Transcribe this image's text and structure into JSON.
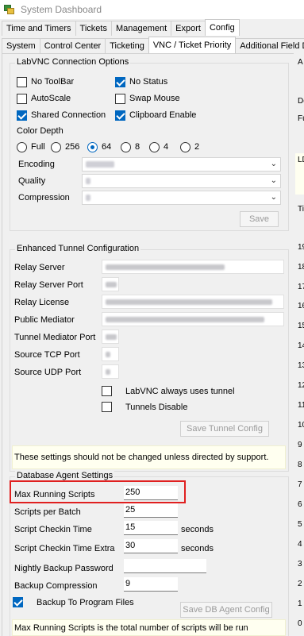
{
  "window": {
    "title": "System Dashboard"
  },
  "main_tabs": [
    "Time and Timers",
    "Tickets",
    "Management",
    "Export",
    "Config"
  ],
  "sub_tabs": [
    "System",
    "Control Center",
    "Ticketing",
    "VNC / Ticket Priority",
    "Additional Field D"
  ],
  "labvnc": {
    "title": "LabVNC Connection Options",
    "checkboxes": [
      {
        "label": "No ToolBar",
        "checked": false
      },
      {
        "label": "No Status",
        "checked": true
      },
      {
        "label": "AutoScale",
        "checked": false
      },
      {
        "label": "Swap Mouse",
        "checked": false
      },
      {
        "label": "Shared Connection",
        "checked": true
      },
      {
        "label": "Clipboard Enable",
        "checked": true
      }
    ],
    "color_depth_label": "Color Depth",
    "color_options": [
      "Full",
      "256",
      "64",
      "8",
      "4",
      "2"
    ],
    "color_selected": "64",
    "encoding_label": "Encoding",
    "quality_label": "Quality",
    "compression_label": "Compression",
    "save_label": "Save"
  },
  "tunnel": {
    "title": "Enhanced Tunnel Configuration",
    "fields": [
      "Relay Server",
      "Relay Server Port",
      "Relay License",
      "Public Mediator",
      "Tunnel Mediator Port",
      "Source TCP Port",
      "Source UDP Port"
    ],
    "always_tunnel_label": "LabVNC always uses tunnel",
    "disable_label": "Tunnels Disable",
    "save_label": "Save Tunnel Config",
    "note": "These settings should not be changed unless directed by support."
  },
  "db_agent": {
    "title": "Database Agent Settings",
    "fields": [
      {
        "label": "Max Running Scripts",
        "value": "250",
        "unit": ""
      },
      {
        "label": "Scripts per Batch",
        "value": "25",
        "unit": ""
      },
      {
        "label": "Script Checkin Time",
        "value": "15",
        "unit": "seconds"
      },
      {
        "label": "Script Checkin Time Extra",
        "value": "30",
        "unit": "seconds"
      },
      {
        "label": "Nightly Backup Password",
        "value": "",
        "unit": ""
      },
      {
        "label": "Backup Compression",
        "value": "9",
        "unit": ""
      }
    ],
    "backup_label": "Backup To Program Files",
    "backup_checked": true,
    "save_label": "Save DB Agent Config",
    "note": "Max Running Scripts is the total number of scripts will be run"
  },
  "right_pane": {
    "a": "A",
    "do": "Do",
    "fu": "Fu",
    "ld": "LD",
    "ti": "Ti",
    "numbers": [
      "19",
      "18",
      "17",
      "16",
      "15",
      "14",
      "13",
      "12",
      "11",
      "10",
      "9",
      "8",
      "7",
      "6",
      "5",
      "4",
      "3",
      "2",
      "1",
      "0"
    ]
  },
  "colors": {
    "accent": "#0067c0",
    "highlight": "#e02020",
    "note_bg": "#fffff0"
  }
}
